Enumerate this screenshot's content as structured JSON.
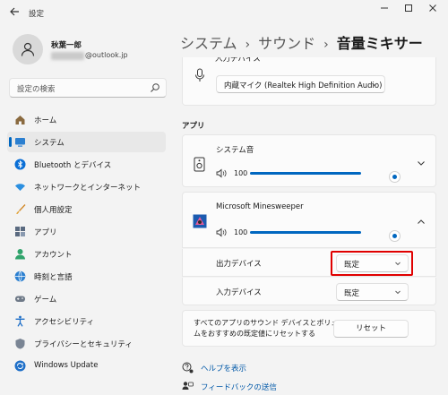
{
  "window": {
    "title": "設定"
  },
  "user": {
    "name": "秋葉一郎",
    "email_suffix": "@outlook.jp"
  },
  "search": {
    "placeholder": "設定の検索"
  },
  "sidebar": {
    "items": [
      {
        "label": "ホーム",
        "icon": "home-icon"
      },
      {
        "label": "システム",
        "icon": "system-icon",
        "active": true
      },
      {
        "label": "Bluetooth とデバイス",
        "icon": "bluetooth-icon"
      },
      {
        "label": "ネットワークとインターネット",
        "icon": "wifi-icon"
      },
      {
        "label": "個人用設定",
        "icon": "brush-icon"
      },
      {
        "label": "アプリ",
        "icon": "apps-icon"
      },
      {
        "label": "アカウント",
        "icon": "account-icon"
      },
      {
        "label": "時刻と言語",
        "icon": "globe-icon"
      },
      {
        "label": "ゲーム",
        "icon": "gamepad-icon"
      },
      {
        "label": "アクセシビリティ",
        "icon": "accessibility-icon"
      },
      {
        "label": "プライバシーとセキュリティ",
        "icon": "shield-icon"
      },
      {
        "label": "Windows Update",
        "icon": "update-icon"
      }
    ]
  },
  "breadcrumb": {
    "items": [
      "システム",
      "サウンド"
    ],
    "current": "音量ミキサー"
  },
  "input_device": {
    "label": "入力デバイス",
    "value": "内蔵マイク (Realtek High Definition Audio)"
  },
  "apps": {
    "section_label": "アプリ",
    "system_sounds": {
      "name": "システム音",
      "volume": 100
    },
    "minesweeper": {
      "name": "Microsoft Minesweeper",
      "volume": 100,
      "output_label": "出力デバイス",
      "output_value": "既定",
      "input_label": "入力デバイス",
      "input_value": "既定"
    }
  },
  "reset": {
    "text": "すべてのアプリのサウンド デバイスとボリュームをおすすめの既定値にリセットする",
    "button": "リセット"
  },
  "links": {
    "help": "ヘルプを表示",
    "feedback": "フィードバックの送信"
  },
  "colors": {
    "accent": "#0067c0",
    "highlight": "#e00000"
  }
}
